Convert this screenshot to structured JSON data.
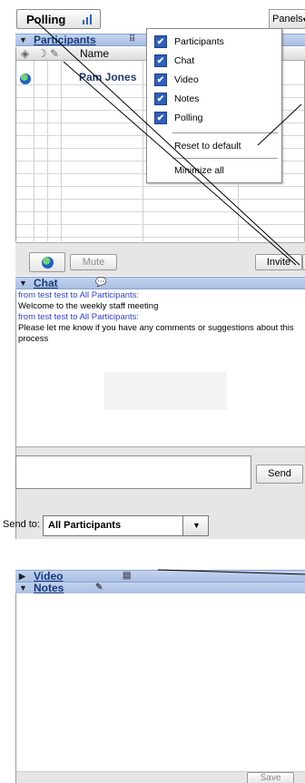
{
  "toolbar": {
    "polling_label": "Polling",
    "panels_label": "Panels"
  },
  "participants": {
    "title": "Participants",
    "col_name": "Name",
    "rows": [
      {
        "name": "Pam Jones"
      }
    ],
    "mute_label": "Mute",
    "invite_label": "Invite"
  },
  "chat": {
    "title": "Chat",
    "messages": [
      {
        "from": "from test test to All Participants:",
        "text": "Welcome to the weekly staff meeting"
      },
      {
        "from": "from test test to All Participants:",
        "text": "Please let me know if you have any comments or suggestions about this process"
      }
    ],
    "send_label": "Send",
    "send_to_label": "Send to:",
    "send_to_value": "All Participants"
  },
  "video": {
    "title": "Video"
  },
  "notes": {
    "title": "Notes",
    "save_label": "Save"
  },
  "panels_menu": {
    "items": [
      {
        "label": "Participants",
        "checked": true
      },
      {
        "label": "Chat",
        "checked": true
      },
      {
        "label": "Video",
        "checked": true
      },
      {
        "label": "Notes",
        "checked": true
      },
      {
        "label": "Polling",
        "checked": true
      }
    ],
    "reset_label": "Reset to default",
    "minimize_label": "Minimize all"
  },
  "colors": {
    "header": "#b4c7e7",
    "link": "#2f3ed0",
    "check": "#2d5fbd"
  }
}
